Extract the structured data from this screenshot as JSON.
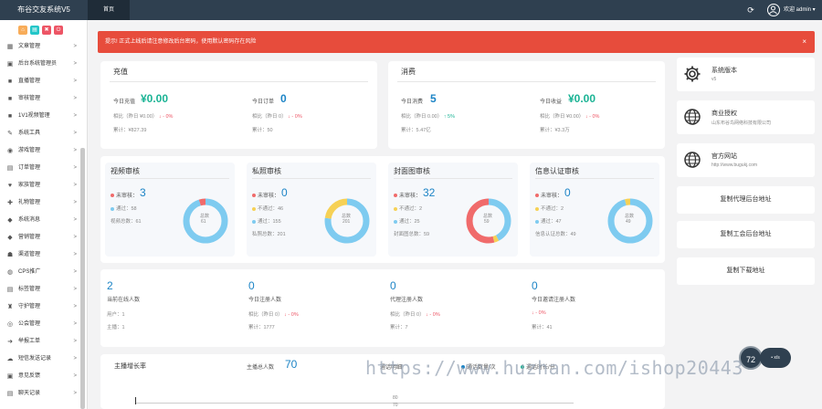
{
  "topbar": {
    "brand": "布谷交友系统V5",
    "tab": "首页",
    "user": "欢迎 admin ▾"
  },
  "sidebar": {
    "items": [
      {
        "icon": "▦",
        "label": "文章管理"
      },
      {
        "icon": "▣",
        "label": "后台系统管理员"
      },
      {
        "icon": "■",
        "label": "直播管理"
      },
      {
        "icon": "■",
        "label": "审核管理"
      },
      {
        "icon": "■",
        "label": "1V1视频管理"
      },
      {
        "icon": "✎",
        "label": "系统工具"
      },
      {
        "icon": "◉",
        "label": "游戏管理"
      },
      {
        "icon": "▤",
        "label": "订单管理"
      },
      {
        "icon": "♥",
        "label": "家族管理"
      },
      {
        "icon": "✚",
        "label": "礼物管理"
      },
      {
        "icon": "◆",
        "label": "系统消息"
      },
      {
        "icon": "◆",
        "label": "营销管理"
      },
      {
        "icon": "☗",
        "label": "渠道管理"
      },
      {
        "icon": "◍",
        "label": "CPS推广"
      },
      {
        "icon": "▤",
        "label": "标签管理"
      },
      {
        "icon": "♜",
        "label": "守护管理"
      },
      {
        "icon": "◎",
        "label": "公会管理"
      },
      {
        "icon": "➜",
        "label": "举报工单"
      },
      {
        "icon": "☁",
        "label": "短信发送记录"
      },
      {
        "icon": "▣",
        "label": "意见反馈"
      },
      {
        "icon": "▤",
        "label": "聊天记录"
      }
    ]
  },
  "alert": {
    "text": "提示! 正式上线后请注意修改后台密码，使用默认密码存在风险",
    "close": "×"
  },
  "recharge": {
    "title": "充值",
    "today_amount_label": "今日充值",
    "today_amount": "¥0.00",
    "today_amount_cmp": "相比（昨日 ¥0.00）",
    "today_amount_delta": "↓ - 0%",
    "total_amount": "累计：¥827.39",
    "today_orders_label": "今日订单",
    "today_orders": "0",
    "today_orders_cmp": "相比（昨日 0）",
    "today_orders_delta": "↓ - 0%",
    "total_orders": "累计：50"
  },
  "consume": {
    "title": "消费",
    "today_label": "今日消费",
    "today": "5",
    "today_cmp": "相比（昨日 0.00）",
    "today_delta": "↑ 5%",
    "total": "累计：5.47亿",
    "income_label": "今日收益",
    "income": "¥0.00",
    "income_cmp": "相比（昨日 ¥0.00）",
    "income_delta": "↓ - 0%",
    "income_total": "累计：¥3.3万"
  },
  "review": [
    {
      "title": "视频审核",
      "pending_label": "未审核：",
      "pending": "3",
      "passed": "通过：58",
      "total": "视频总数：61",
      "ring_label": "总数",
      "ring_total": "61"
    },
    {
      "title": "私照审核",
      "pending_label": "未审核：",
      "pending": "0",
      "failed": "不通过：46",
      "passed": "通过：155",
      "total": "私照总数：201",
      "ring_label": "总数",
      "ring_total": "201"
    },
    {
      "title": "封面图审核",
      "pending_label": "未审核：",
      "pending": "32",
      "failed": "不通过：2",
      "passed": "通过：25",
      "total": "封面图总数：59",
      "ring_label": "总数",
      "ring_total": "59"
    },
    {
      "title": "信息认证审核",
      "pending_label": "未审核：",
      "pending": "0",
      "failed": "不通过：2",
      "passed": "通过：47",
      "total": "信息认证总数：49",
      "ring_label": "总数",
      "ring_total": "49"
    }
  ],
  "users": [
    {
      "value": "2",
      "label": "当前在线人数",
      "l1": "用户：1",
      "l2": "主播：1"
    },
    {
      "value": "0",
      "label": "今日注册人数",
      "l1": "相比（昨日 0）",
      "d1": "↓ - 0%",
      "l2": "累计：1777"
    },
    {
      "value": "0",
      "label": "代理注册人数",
      "l1": "相比（昨日 0）",
      "d1": "↓ - 0%",
      "l2": "累计：7"
    },
    {
      "value": "0",
      "label": "今日邀请注册人数",
      "l1": "",
      "d1": "↓ - 0%",
      "l2": "累计：41"
    }
  ],
  "bottom": {
    "growth": "主播增长率",
    "total_label": "主播总人数",
    "total": "70",
    "source": "通话明细",
    "legend1": "通话数量/次",
    "legend2": "通话时长/分",
    "axis1": "80",
    "axis2": "70"
  },
  "rightcards": [
    {
      "title": "系统版本",
      "sub": "v5",
      "icon": "gear-icon"
    },
    {
      "title": "商业授权",
      "sub": "山东布谷鸟网络科技有限公司",
      "icon": "globe-icon"
    },
    {
      "title": "官方网站",
      "sub": "http://www.bugukj.com",
      "icon": "globe-icon"
    }
  ],
  "rightbuttons": [
    "复制代理后台地址",
    "复制工会后台地址",
    "复制下载地址"
  ],
  "float": {
    "circle": "72",
    "pill": "• x/s"
  },
  "watermark": "https://www.huzhan.com/ishop20443",
  "colors": {
    "sidebar_dark": "#2f4050",
    "alert": "#e74c3c",
    "accent_blue": "#1c84c6",
    "accent_green": "#1ab394",
    "ring_blue": "#7ecbf0",
    "ring_red": "#f06b6b",
    "ring_yellow": "#f6d155"
  },
  "ring_values": [
    {
      "total": 61,
      "pending": 3,
      "failed": 0,
      "passed": 58
    },
    {
      "total": 201,
      "pending": 0,
      "failed": 46,
      "passed": 155
    },
    {
      "total": 59,
      "pending": 32,
      "failed": 2,
      "passed": 25
    },
    {
      "total": 49,
      "pending": 0,
      "failed": 2,
      "passed": 47
    }
  ]
}
